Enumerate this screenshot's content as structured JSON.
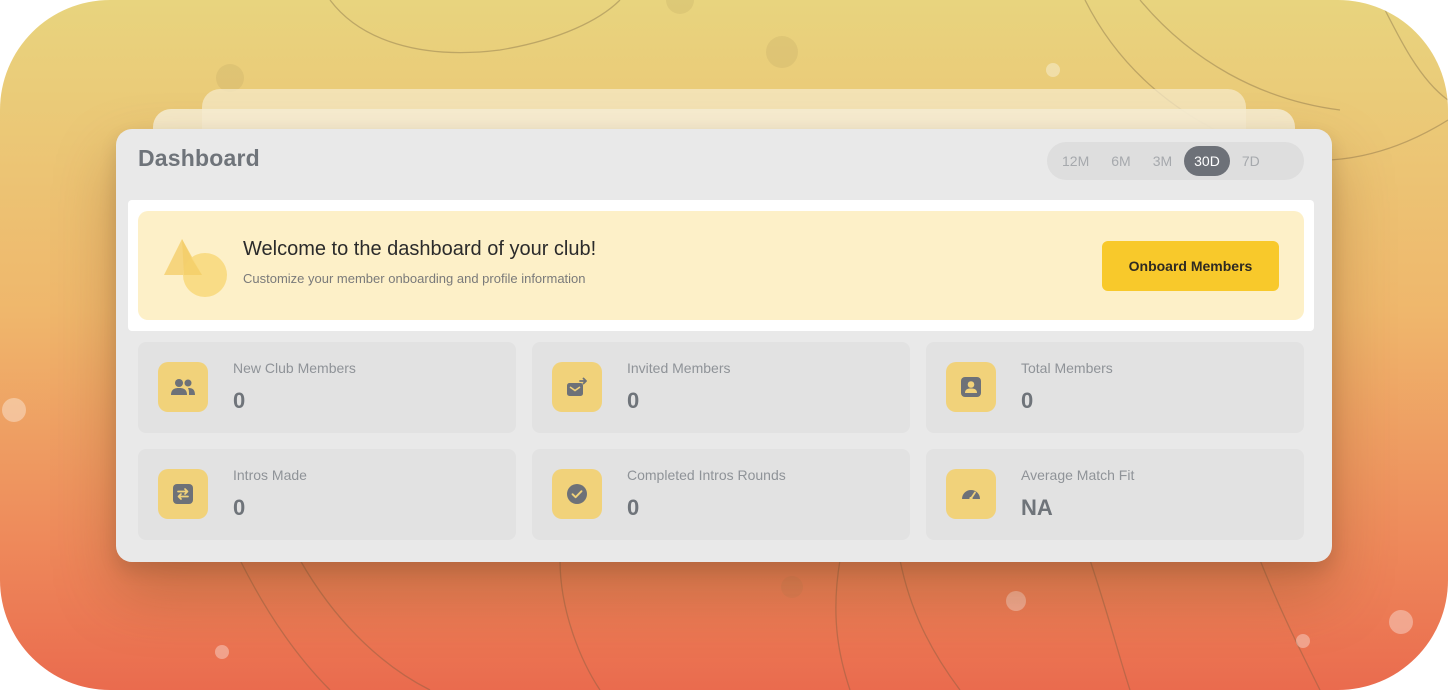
{
  "header": {
    "title": "Dashboard"
  },
  "periods": {
    "options": [
      "12M",
      "6M",
      "3M",
      "30D",
      "7D"
    ],
    "selected": "30D"
  },
  "welcome": {
    "title": "Welcome to the dashboard of your club!",
    "subtitle": "Customize your member onboarding and profile information",
    "button_label": "Onboard Members"
  },
  "stats": [
    {
      "label": "New Club Members",
      "value": "0",
      "icon": "group-icon"
    },
    {
      "label": "Invited Members",
      "value": "0",
      "icon": "mail-send-icon"
    },
    {
      "label": "Total Members",
      "value": "0",
      "icon": "member-badge-icon"
    },
    {
      "label": "Intros Made",
      "value": "0",
      "icon": "swap-icon"
    },
    {
      "label": "Completed Intros Rounds",
      "value": "0",
      "icon": "check-circle-icon"
    },
    {
      "label": "Average Match Fit",
      "value": "NA",
      "icon": "gauge-icon"
    }
  ],
  "colors": {
    "accent": "#f8c92b",
    "icon_tile": "#f1d27a",
    "icon_glyph": "#6d7178",
    "banner": "#fdf0c8",
    "period_active": "#6d7178"
  }
}
